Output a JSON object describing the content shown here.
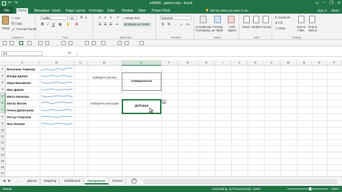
{
  "window": {
    "title": "m04l06 - gotovo.xlsx - Excel",
    "sign_in": "Sign in",
    "share": "Share"
  },
  "ribbon": {
    "tabs": [
      "File",
      "Home",
      "Вмъкване",
      "Insert",
      "Page Layout",
      "Formulas",
      "Data",
      "Review",
      "View",
      "Power Pivot"
    ],
    "active_tab": "Home",
    "tell_me": "Tell me what you want to do...",
    "clipboard": {
      "paste": "Paste",
      "cut": "Cut",
      "copy": "Copy",
      "format_painter": "Format Painter",
      "label": "Clipboard"
    },
    "font": {
      "name": "Calibri",
      "size": "11",
      "label": "Font"
    },
    "alignment": {
      "wrap": "Wrap Text",
      "merge": "Merge & Center",
      "label": "Alignment"
    },
    "number": {
      "format": "General",
      "label": "Number"
    },
    "styles": {
      "conditional": "Conditional Formatting",
      "table": "Format as Table",
      "cell": "Cell Styles",
      "label": "Styles"
    },
    "cells": {
      "insert": "Insert",
      "delete": "Delete",
      "format": "Format",
      "label": "Cells"
    },
    "editing": {
      "autosum": "AutoSum",
      "fill": "Fill",
      "clear": "Clear",
      "sort": "Sort & Filter",
      "find": "Find & Select",
      "label": "Editing"
    }
  },
  "formula_bar": {
    "name_box": "E3",
    "fx": "fx",
    "content": ""
  },
  "columns": [
    "A",
    "B",
    "C",
    "D",
    "E",
    "F",
    "G",
    "H",
    "I",
    "J",
    "K",
    "L",
    "M",
    "N",
    "O",
    "P"
  ],
  "selected_column": "E",
  "rows": [
    "1",
    "2",
    "3",
    "4",
    "5",
    "6",
    "7",
    "8",
    "9",
    "10",
    "11",
    "12",
    "13",
    "14",
    "15",
    "16",
    "17"
  ],
  "selected_rows": [
    "5",
    "6",
    "7"
  ],
  "names": [
    "Василена Томкова",
    "Влади Димов",
    "Иван Михайлов",
    "Иво Димов",
    "Мила Иванова",
    "Митко Велев",
    "Пенка Димитрова",
    "Петър Георгиев",
    "Яна Попова"
  ],
  "labels": {
    "region_prompt": "Изберете регион",
    "category_prompt": "Изберете категория"
  },
  "values": {
    "region": "Североизток",
    "category": "Добавки"
  },
  "sheets": [
    "Данни",
    "Mapping",
    "Dashboard",
    "Продавачи",
    "Sheet2"
  ],
  "active_sheet": "Продавачи",
  "status": {
    "ready": "Ready",
    "calculating": "Calculating: (4 Processor(s)): 100%",
    "zoom": "100%"
  },
  "colors": {
    "accent": "#217346",
    "sparkline": "#5b8dc9"
  }
}
